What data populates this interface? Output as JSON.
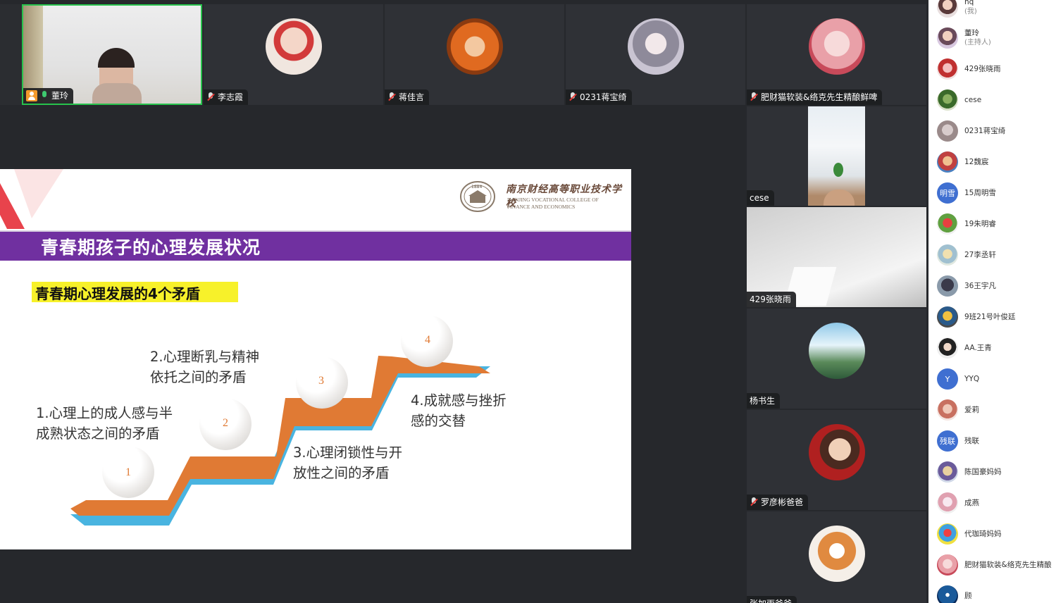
{
  "top_tiles": [
    {
      "name": "董玲"
    },
    {
      "name": "李志霞"
    },
    {
      "name": "蒋佳言"
    },
    {
      "name": "0231蒋宝绮"
    },
    {
      "name": "肥财猫软装&络克先生精酿鲜啤"
    }
  ],
  "right_tiles": [
    {
      "name": "cese"
    },
    {
      "name": "429张晓雨"
    },
    {
      "name": "杨书生"
    },
    {
      "name": "罗彦彬爸爸"
    },
    {
      "name": "张加雨爸爸"
    }
  ],
  "slide": {
    "logo_cn": "南京财经高等职业技术学校",
    "logo_en1": "NANJING VOCATIONAL COLLEGE OF",
    "logo_en2": "FINANCE AND ECONOMICS",
    "logo_year": "1884",
    "banner_title": "青春期孩子的心理发展状况",
    "subtitle": "青春期心理发展的4个矛盾",
    "items": [
      {
        "line1": "1.心理上的成人感与半",
        "line2": "成熟状态之间的矛盾",
        "num": "1"
      },
      {
        "line1": "2.心理断乳与精神",
        "line2": "依托之间的矛盾",
        "num": "2"
      },
      {
        "line1": "3.心理闭锁性与开",
        "line2": "放性之间的矛盾",
        "num": "3"
      },
      {
        "line1": "4.成就感与挫折",
        "line2": "感的交替",
        "num": "4"
      }
    ]
  },
  "participants": [
    {
      "name": "hq",
      "sub": "(我)"
    },
    {
      "name": "董玲",
      "sub": "(主持人)"
    },
    {
      "name": "429张晓雨"
    },
    {
      "name": "cese"
    },
    {
      "name": "0231蒋宝绮"
    },
    {
      "name": "12魏宸"
    },
    {
      "name": "15周明雪",
      "avatar_text": "明雪"
    },
    {
      "name": "19朱明睿"
    },
    {
      "name": "27李丞轩"
    },
    {
      "name": "36王宇凡"
    },
    {
      "name": "9班21号叶俊廷"
    },
    {
      "name": "AA.王青"
    },
    {
      "name": "YYQ",
      "avatar_text": "Y"
    },
    {
      "name": "爱莉"
    },
    {
      "name": "残联",
      "avatar_text": "残联"
    },
    {
      "name": "陈国豪妈妈"
    },
    {
      "name": "成燕"
    },
    {
      "name": "代珈琦妈妈"
    },
    {
      "name": "肥财猫软装&络克先生精酿"
    },
    {
      "name": "顾"
    }
  ],
  "colors": {
    "bg": "#26282c",
    "tile": "#2f3136",
    "active_border": "#27c24c",
    "banner": "#7030a0",
    "step_orange": "#e07a34",
    "step_blue": "#49b4e0",
    "highlight": "#f7f12a",
    "avatar_blue": "#3f6fd1"
  },
  "icons": [
    "microphone-muted-icon",
    "microphone-on-icon",
    "host-user-icon"
  ]
}
